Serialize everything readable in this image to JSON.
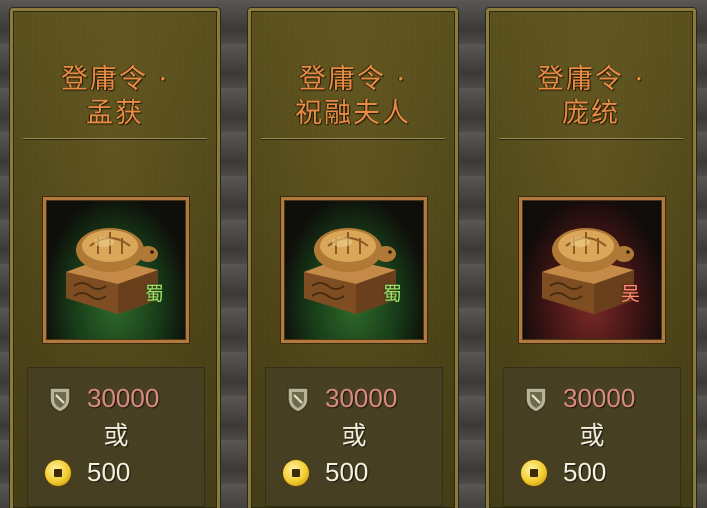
{
  "cards": [
    {
      "title_line1": "登庸令 ·",
      "title_line2": "孟获",
      "faction": "蜀",
      "faction_color": "#9ae06c",
      "item_icon": "turtle-seal-icon",
      "cost_jade": "30000",
      "or_label": "或",
      "cost_gold": "500"
    },
    {
      "title_line1": "登庸令 ·",
      "title_line2": "祝融夫人",
      "faction": "蜀",
      "faction_color": "#9ae06c",
      "item_icon": "turtle-seal-icon",
      "cost_jade": "30000",
      "or_label": "或",
      "cost_gold": "500"
    },
    {
      "title_line1": "登庸令 ·",
      "title_line2": "庞统",
      "faction": "吴",
      "faction_color": "#ff8a78",
      "item_icon": "turtle-seal-icon",
      "cost_jade": "30000",
      "or_label": "或",
      "cost_gold": "500"
    }
  ],
  "currency_icons": {
    "jade": "shield-token-icon",
    "gold": "gold-coin-icon"
  },
  "colors": {
    "title": "#e98a45",
    "jade_price": "#d98a84",
    "gold_price": "#f3f0e2",
    "card_border": "#8a7a3c",
    "frame_border": "#b2793c"
  }
}
